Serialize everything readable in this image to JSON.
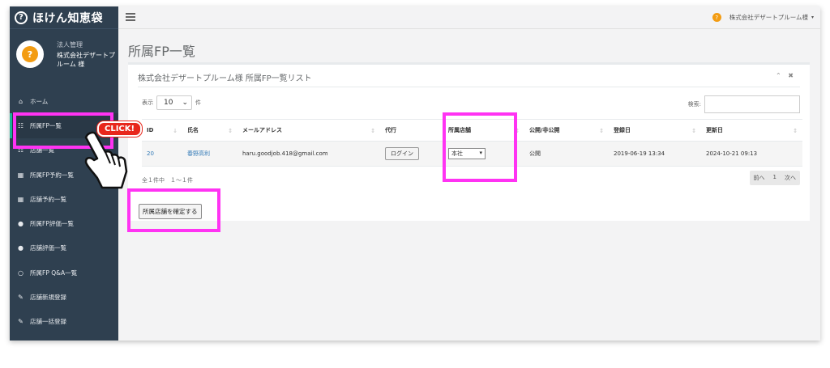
{
  "brand": {
    "logo": "?",
    "name": "ほけん知恵袋"
  },
  "profile": {
    "role": "法人管理",
    "name": "株式会社デザートプルーム 様"
  },
  "nav": [
    {
      "icon": "home-icon",
      "glyph": "⌂",
      "label": "ホーム"
    },
    {
      "icon": "sitemap-icon",
      "glyph": "☷",
      "label": "所属FP一覧"
    },
    {
      "icon": "sitemap-icon",
      "glyph": "☷",
      "label": "店舗一覧"
    },
    {
      "icon": "calendar-icon",
      "glyph": "▦",
      "label": "所属FP予約一覧"
    },
    {
      "icon": "calendar-icon",
      "glyph": "▦",
      "label": "店舗予約一覧"
    },
    {
      "icon": "comment-icon",
      "glyph": "●",
      "label": "所属FP評価一覧"
    },
    {
      "icon": "comment-icon",
      "glyph": "●",
      "label": "店舗評価一覧"
    },
    {
      "icon": "comments-icon",
      "glyph": "○",
      "label": "所属FP Q&A一覧"
    },
    {
      "icon": "edit-icon",
      "glyph": "✎",
      "label": "店舗新規登録"
    },
    {
      "icon": "edit-icon",
      "glyph": "✎",
      "label": "店舗一括登録"
    }
  ],
  "topbar": {
    "user": "株式会社デザートプルーム様",
    "caret": "▾"
  },
  "page": {
    "title": "所属FP一覧"
  },
  "panel": {
    "title": "株式会社デザートプルーム様 所属FP一覧リスト",
    "collapse": "⌃",
    "close": "✖"
  },
  "list_controls": {
    "show_prefix": "表示",
    "page_size": "10",
    "show_suffix": "件",
    "search_label": "検索:",
    "search_value": ""
  },
  "table": {
    "headers": [
      "ID",
      "氏名",
      "メールアドレス",
      "代行",
      "所属店舗",
      "公開/非公開",
      "登録日",
      "更新日"
    ],
    "rows": [
      {
        "id": "20",
        "name": "春野高利",
        "email": "haru.goodjob.418@gmail.com",
        "proxy": "ログイン",
        "store": "本社",
        "visibility": "公開",
        "registered": "2019-06-19 13:34",
        "updated": "2024-10-21 09:13"
      }
    ]
  },
  "info": "全１件中　１〜１件",
  "pager": {
    "prev": "前へ",
    "page": "1",
    "next": "次へ"
  },
  "confirm_button": "所属店舗を確定する",
  "annotation": {
    "click_label": "CLICK!",
    "highlight_color": "#ff33f3"
  }
}
